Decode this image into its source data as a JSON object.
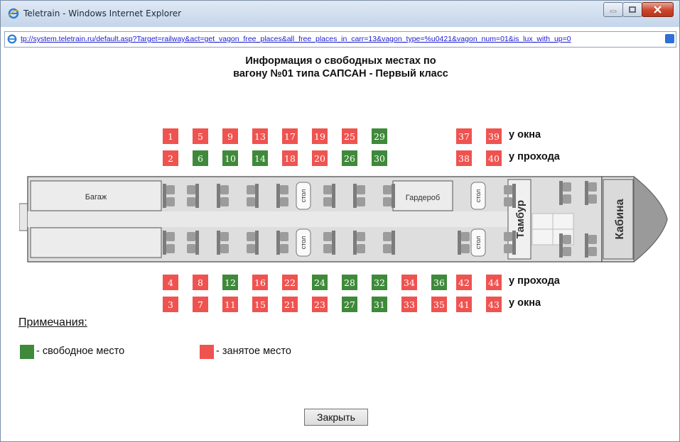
{
  "window": {
    "title": "Teletrain - Windows Internet Explorer",
    "url": "tp://system.teletrain.ru/default.asp?Target=railway&act=get_vagon_free_places&all_free_places_in_carr=13&vagon_type=%u0421&vagon_num=01&is_lux_with_up=0"
  },
  "heading": {
    "line1": "Информация о свободных местах по",
    "line2": "вагону №01 типа САПСАН - Первый класс"
  },
  "colors": {
    "free": "#3f8a3a",
    "occupied": "#ef5350"
  },
  "seats": {
    "top_window": [
      {
        "n": "1",
        "status": "occupied"
      },
      {
        "n": "5",
        "status": "occupied"
      },
      {
        "n": "9",
        "status": "occupied"
      },
      {
        "n": "13",
        "status": "occupied"
      },
      {
        "n": "17",
        "status": "occupied"
      },
      {
        "n": "19",
        "status": "occupied"
      },
      {
        "n": "25",
        "status": "occupied"
      },
      {
        "n": "29",
        "status": "free"
      },
      {
        "n": "37",
        "status": "occupied"
      },
      {
        "n": "39",
        "status": "occupied"
      }
    ],
    "top_aisle": [
      {
        "n": "2",
        "status": "occupied"
      },
      {
        "n": "6",
        "status": "free"
      },
      {
        "n": "10",
        "status": "free"
      },
      {
        "n": "14",
        "status": "free"
      },
      {
        "n": "18",
        "status": "occupied"
      },
      {
        "n": "20",
        "status": "occupied"
      },
      {
        "n": "26",
        "status": "free"
      },
      {
        "n": "30",
        "status": "free"
      },
      {
        "n": "38",
        "status": "occupied"
      },
      {
        "n": "40",
        "status": "occupied"
      }
    ],
    "bottom_aisle": [
      {
        "n": "4",
        "status": "occupied"
      },
      {
        "n": "8",
        "status": "occupied"
      },
      {
        "n": "12",
        "status": "free"
      },
      {
        "n": "16",
        "status": "occupied"
      },
      {
        "n": "22",
        "status": "occupied"
      },
      {
        "n": "24",
        "status": "free"
      },
      {
        "n": "28",
        "status": "free"
      },
      {
        "n": "32",
        "status": "free"
      },
      {
        "n": "34",
        "status": "occupied"
      },
      {
        "n": "36",
        "status": "free"
      },
      {
        "n": "42",
        "status": "occupied"
      },
      {
        "n": "44",
        "status": "occupied"
      }
    ],
    "bottom_window": [
      {
        "n": "3",
        "status": "occupied"
      },
      {
        "n": "7",
        "status": "occupied"
      },
      {
        "n": "11",
        "status": "occupied"
      },
      {
        "n": "15",
        "status": "occupied"
      },
      {
        "n": "21",
        "status": "occupied"
      },
      {
        "n": "23",
        "status": "occupied"
      },
      {
        "n": "27",
        "status": "free"
      },
      {
        "n": "31",
        "status": "free"
      },
      {
        "n": "33",
        "status": "occupied"
      },
      {
        "n": "35",
        "status": "occupied"
      },
      {
        "n": "41",
        "status": "occupied"
      },
      {
        "n": "43",
        "status": "occupied"
      }
    ]
  },
  "row_labels": {
    "window": "у окна",
    "aisle": "у прохода"
  },
  "train_labels": {
    "baggage": "Багаж",
    "wardrobe": "Гардероб",
    "table": "стол",
    "vestibule": "Тамбур",
    "cabin": "Кабина"
  },
  "notes": {
    "title": "Примечания:",
    "free_label": "- свободное место",
    "occupied_label": "- занятое место"
  },
  "close_button": "Закрыть"
}
